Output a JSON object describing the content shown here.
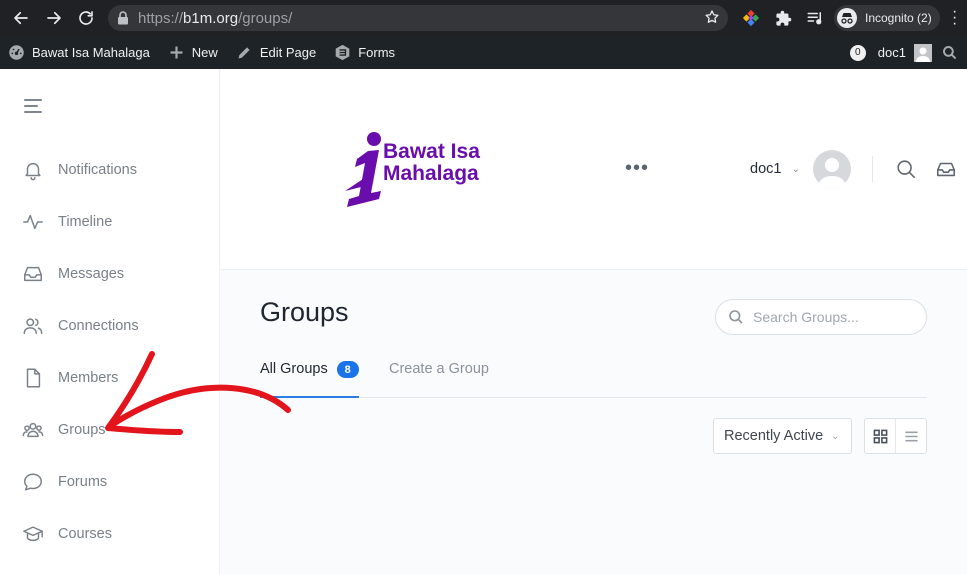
{
  "browser": {
    "url_scheme": "https://",
    "url_host": "b1m.org",
    "url_path": "/groups/",
    "profile_label": "Incognito (2)"
  },
  "adminbar": {
    "site_name": "Bawat Isa Mahalaga",
    "new_label": "New",
    "edit_label": "Edit Page",
    "forms_label": "Forms",
    "notification_count": "0",
    "user_name": "doc1"
  },
  "sidebar": {
    "items": [
      {
        "label": "Notifications",
        "icon": "bell-icon"
      },
      {
        "label": "Timeline",
        "icon": "activity-icon"
      },
      {
        "label": "Messages",
        "icon": "inbox-icon"
      },
      {
        "label": "Connections",
        "icon": "users-icon"
      },
      {
        "label": "Members",
        "icon": "file-icon"
      },
      {
        "label": "Groups",
        "icon": "groups-icon"
      },
      {
        "label": "Forums",
        "icon": "chat-icon"
      },
      {
        "label": "Courses",
        "icon": "graduation-cap-icon"
      }
    ]
  },
  "header": {
    "logo_line1": "Bawat Isa",
    "logo_line2": "Mahalaga",
    "user_name": "doc1",
    "logo_color": "#6a0dad"
  },
  "main": {
    "title": "Groups",
    "search_placeholder": "Search Groups...",
    "tabs": [
      {
        "label": "All Groups",
        "count": "8",
        "active": true
      },
      {
        "label": "Create a Group",
        "active": false
      }
    ],
    "sort_label": "Recently Active"
  },
  "colors": {
    "accent": "#1a73e8",
    "annotation_arrow": "#e3141b"
  }
}
